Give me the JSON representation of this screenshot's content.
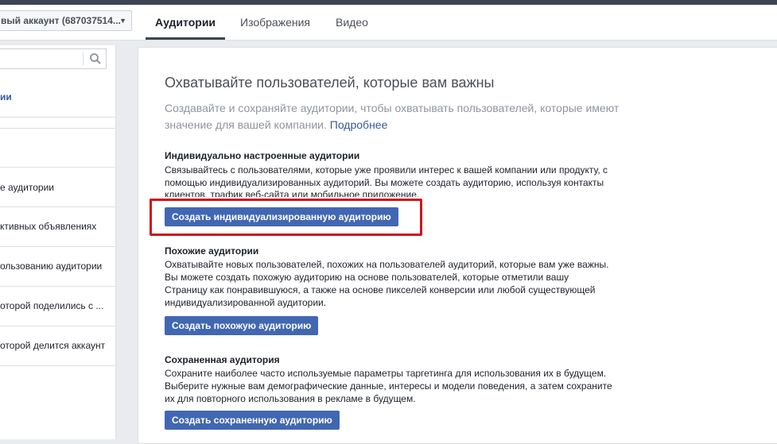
{
  "header": {
    "account_label": "вый аккаунт (687037514...",
    "tabs": [
      {
        "label": "Аудитории",
        "active": true
      },
      {
        "label": "Изображения",
        "active": false
      },
      {
        "label": "Видео",
        "active": false
      }
    ]
  },
  "sidebar": {
    "search_placeholder": "",
    "active_item": "ии",
    "items": [
      {
        "label": "е аудитории"
      },
      {
        "label": "ктивных объявлениях"
      },
      {
        "label": "ользованию аудитории"
      },
      {
        "label": "оторой поделились с ..."
      },
      {
        "label": "оторой делится аккаунт"
      }
    ]
  },
  "main": {
    "title": "Охватывайте пользователей, которые вам важны",
    "description": "Создавайте и сохраняйте аудитории, чтобы охватывать пользователей, которые имеют значение для вашей компании.",
    "learn_more": "Подробнее",
    "sections": [
      {
        "title": "Индивидуально настроенные аудитории",
        "text_visible": "Связывайтесь с пользователями, которые уже проявили интерес к вашей компании или продукту, с помощью индивидуализированных аудиторий. Вы можете создать аудиторию, используя контакты",
        "text_clipped": "клиентов, трафик веб-сайта или мобильное приложение.",
        "button": "Создать индивидуализированную аудиторию"
      },
      {
        "title": "Похожие аудитории",
        "text": "Охватывайте новых пользователей, похожих на пользователей аудиторий, которые вам уже важны. Вы можете создать похожую аудиторию на основе пользователей, которые отметили вашу Страницу как понравившуюся, а также на основе пикселей конверсии или любой существующей индивидуализированной аудитории.",
        "button": "Создать похожую аудиторию"
      },
      {
        "title": "Сохраненная аудитория",
        "text": "Сохраните наиболее часто используемые параметры таргетинга для использования их в будущем. Выберите нужные вам демографические данные, интересы и модели поведения, а затем сохраните их для повторного использования в рекламе в будущем.",
        "button": "Создать сохраненную аудиторию"
      }
    ]
  },
  "colors": {
    "button_blue": "#4267b2",
    "link_blue": "#365899",
    "highlight_red": "#d0121b",
    "topbar": "#3b4452"
  }
}
